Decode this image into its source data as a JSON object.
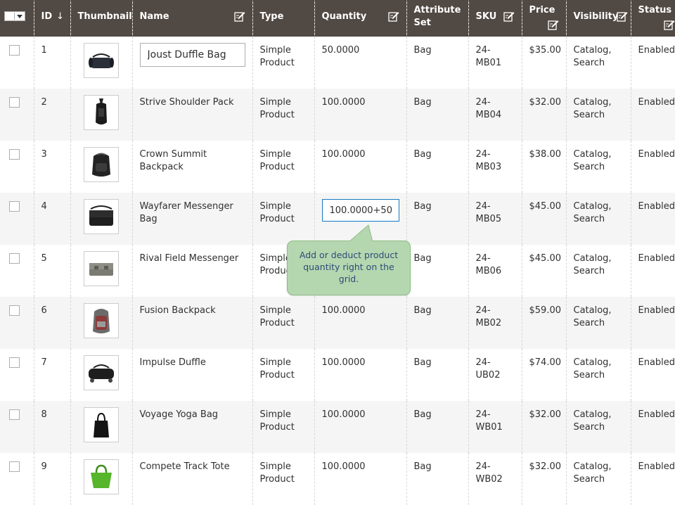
{
  "columns": {
    "id": "ID",
    "id_sort": "↓",
    "thumbnail": "Thumbnail",
    "name": "Name",
    "type": "Type",
    "quantity": "Quantity",
    "attribute_set_line1": "Attribute",
    "attribute_set_line2": "Set",
    "sku": "SKU",
    "price": "Price",
    "visibility": "Visibility",
    "status": "Status"
  },
  "rows": [
    {
      "id": "1",
      "name": "Joust Duffle Bag",
      "type1": "Simple",
      "type2": "Product",
      "qty": "50.0000",
      "attr": "Bag",
      "sku": "24-MB01",
      "price": "$35.00",
      "vis1": "Catalog,",
      "vis2": "Search",
      "status": "Enabled",
      "thumb_icon": "duffle-bag-icon"
    },
    {
      "id": "2",
      "name": "Strive Shoulder Pack",
      "type1": "Simple",
      "type2": "Product",
      "qty": "100.0000",
      "attr": "Bag",
      "sku": "24-MB04",
      "price": "$32.00",
      "vis1": "Catalog,",
      "vis2": "Search",
      "status": "Enabled",
      "thumb_icon": "shoulder-pack-icon"
    },
    {
      "id": "3",
      "name": "Crown Summit Backpack",
      "type1": "Simple",
      "type2": "Product",
      "qty": "100.0000",
      "attr": "Bag",
      "sku": "24-MB03",
      "price": "$38.00",
      "vis1": "Catalog,",
      "vis2": "Search",
      "status": "Enabled",
      "thumb_icon": "backpack-icon"
    },
    {
      "id": "4",
      "name1": "Wayfarer Messenger",
      "name2": "Bag",
      "type1": "Simple",
      "type2": "Product",
      "qty": "100.0000+50",
      "attr": "Bag",
      "sku": "24-MB05",
      "price": "$45.00",
      "vis1": "Catalog,",
      "vis2": "Search",
      "status": "Enabled",
      "thumb_icon": "messenger-bag-icon"
    },
    {
      "id": "5",
      "name": "Rival Field Messenger",
      "type1": "Simple",
      "type2": "Product",
      "qty": "",
      "attr": "Bag",
      "sku": "24-MB06",
      "price": "$45.00",
      "vis1": "Catalog,",
      "vis2": "Search",
      "status": "Enabled",
      "thumb_icon": "field-messenger-icon"
    },
    {
      "id": "6",
      "name": "Fusion Backpack",
      "type1": "Simple",
      "type2": "Product",
      "qty": "100.0000",
      "attr": "Bag",
      "sku": "24-MB02",
      "price": "$59.00",
      "vis1": "Catalog,",
      "vis2": "Search",
      "status": "Enabled",
      "thumb_icon": "fusion-backpack-icon"
    },
    {
      "id": "7",
      "name": "Impulse Duffle",
      "type1": "Simple",
      "type2": "Product",
      "qty": "100.0000",
      "attr": "Bag",
      "sku": "24-UB02",
      "price": "$74.00",
      "vis1": "Catalog,",
      "vis2": "Search",
      "status": "Enabled",
      "thumb_icon": "rolling-duffle-icon"
    },
    {
      "id": "8",
      "name": "Voyage Yoga Bag",
      "type1": "Simple",
      "type2": "Product",
      "qty": "100.0000",
      "attr": "Bag",
      "sku": "24-WB01",
      "price": "$32.00",
      "vis1": "Catalog,",
      "vis2": "Search",
      "status": "Enabled",
      "thumb_icon": "tote-bag-icon"
    },
    {
      "id": "9",
      "name": "Compete Track Tote",
      "type1": "Simple",
      "type2": "Product",
      "qty": "100.0000",
      "attr": "Bag",
      "sku": "24-WB02",
      "price": "$32.00",
      "vis1": "Catalog,",
      "vis2": "Search",
      "status": "Enabled",
      "thumb_icon": "green-tote-icon"
    }
  ],
  "tooltip": {
    "text": "Add or deduct product quantity right on the grid."
  },
  "colors": {
    "header_bg": "#514943",
    "row_alt": "#f5f5f5",
    "tooltip_bg": "#b5d7b0",
    "tooltip_text": "#2d4b76",
    "focus_border": "#1979c3"
  }
}
